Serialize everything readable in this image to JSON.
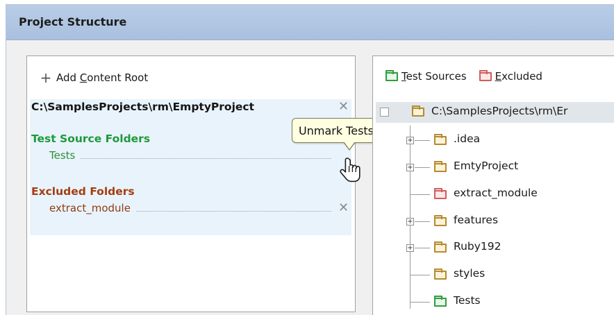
{
  "window": {
    "title": "Project Structure"
  },
  "left_panel": {
    "add_content_root": {
      "icon": "plus-icon",
      "label_prefix": "Add ",
      "label_mnemonic": "C",
      "label_rest": "ontent Root"
    },
    "content_root": {
      "path": "C:\\SamplesProjects\\rm\\EmptyProject",
      "test_sources": {
        "heading": "Test Source Folders",
        "items": [
          "Tests"
        ]
      },
      "excluded": {
        "heading": "Excluded Folders",
        "items": [
          "extract_module"
        ]
      }
    },
    "tooltip": "Unmark Tests"
  },
  "right_panel": {
    "legend": [
      {
        "mnemonic": "T",
        "rest": "est Sources",
        "color": "#2e9d3d"
      },
      {
        "mnemonic": "E",
        "rest": "xcluded",
        "color": "#d25c5c"
      }
    ],
    "tree": {
      "root": "C:\\SamplesProjects\\rm\\Er",
      "children": [
        {
          "label": ".idea",
          "expandable": true,
          "kind": "normal"
        },
        {
          "label": "EmtyProject",
          "expandable": true,
          "kind": "normal"
        },
        {
          "label": "extract_module",
          "expandable": false,
          "kind": "excluded"
        },
        {
          "label": "features",
          "expandable": true,
          "kind": "normal"
        },
        {
          "label": "Ruby192",
          "expandable": true,
          "kind": "normal"
        },
        {
          "label": "styles",
          "expandable": false,
          "kind": "normal"
        },
        {
          "label": "Tests",
          "expandable": false,
          "kind": "test"
        }
      ]
    }
  }
}
